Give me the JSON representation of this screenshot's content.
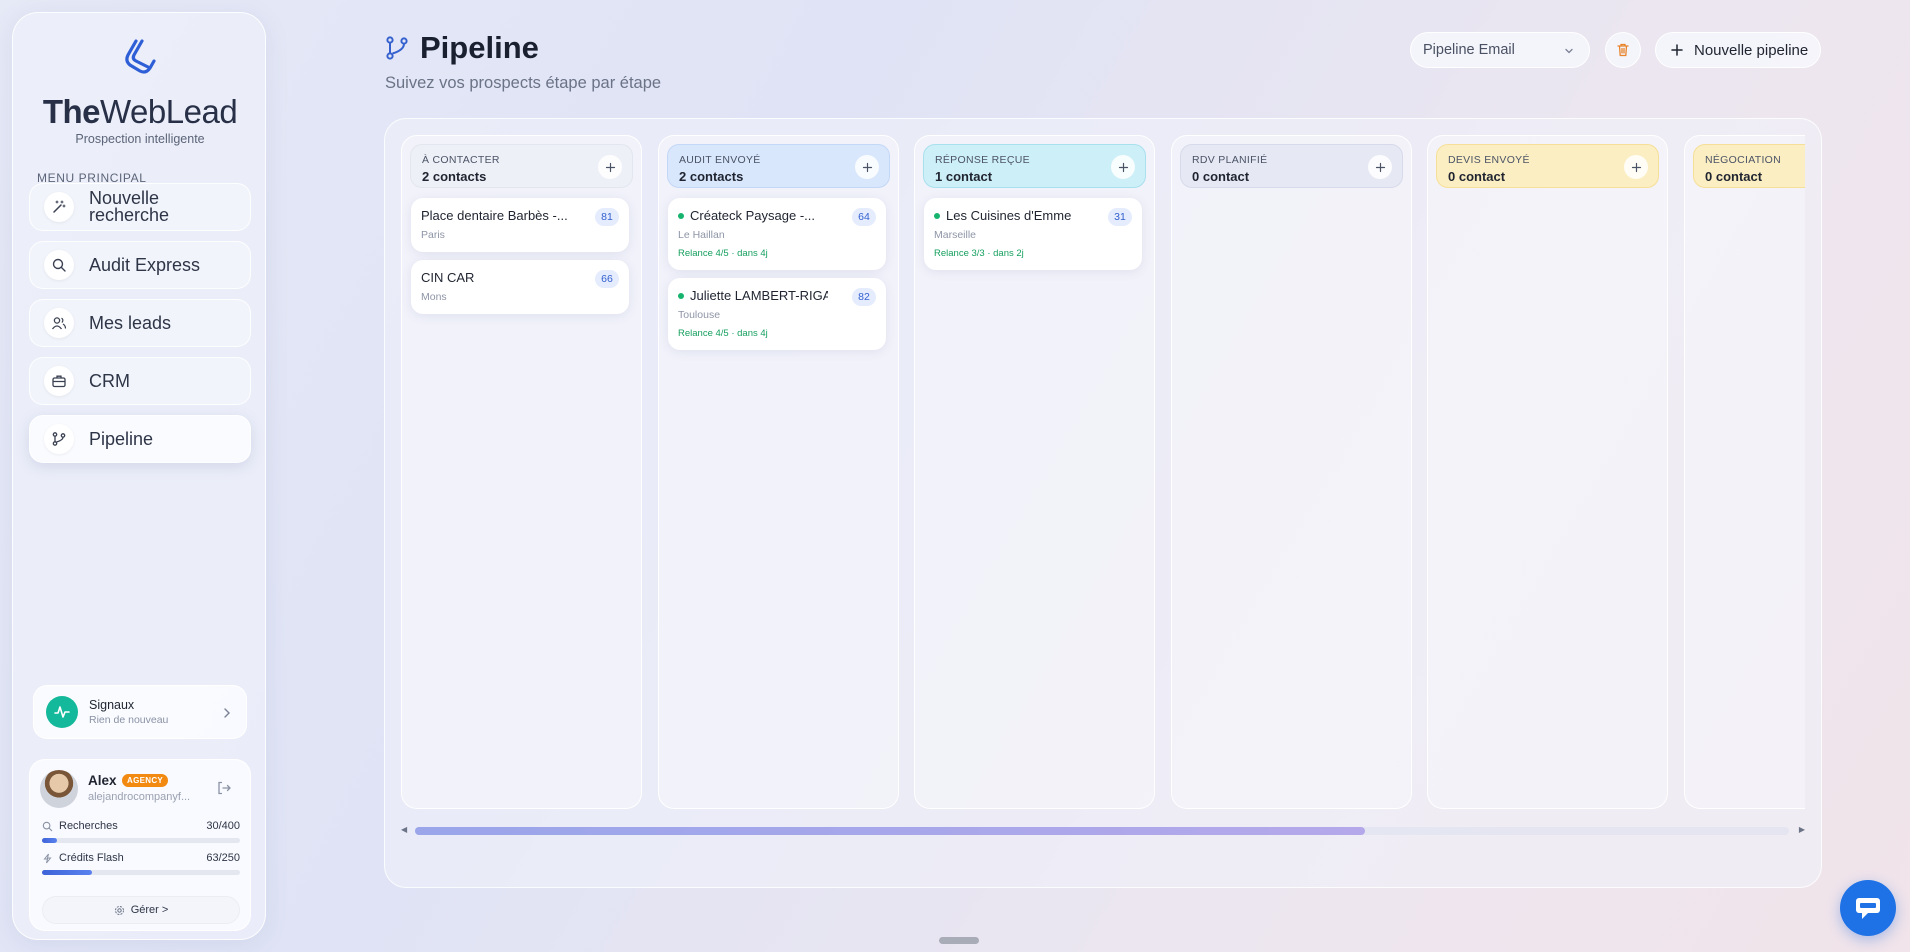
{
  "app": {
    "brand_the": "The",
    "brand_weblead": "WebLead",
    "tagline": "Prospection intelligente"
  },
  "sidebar": {
    "menu_title": "MENU PRINCIPAL",
    "items": [
      {
        "label": "Nouvelle recherche",
        "icon": "magic-wand-icon"
      },
      {
        "label": "Audit Express",
        "icon": "search-icon"
      },
      {
        "label": "Mes leads",
        "icon": "users-icon"
      },
      {
        "label": "CRM",
        "icon": "briefcase-icon"
      },
      {
        "label": "Pipeline",
        "icon": "git-branch-icon",
        "active": true
      }
    ],
    "signals": {
      "title": "Signaux",
      "subtitle": "Rien de nouveau"
    },
    "user": {
      "name": "Alex",
      "badge": "AGENCY",
      "email": "alejandrocompanyf...",
      "quotas": [
        {
          "label": "Recherches",
          "value": "30/400",
          "fraction": 0.075
        },
        {
          "label": "Crédits Flash",
          "value": "63/250",
          "fraction": 0.252
        }
      ],
      "manage_label": "Gérer >"
    }
  },
  "header": {
    "title": "Pipeline",
    "subtitle": "Suivez vos prospects étape par étape",
    "select_value": "Pipeline Email",
    "new_pipeline_label": "Nouvelle pipeline"
  },
  "colors": {
    "accent": "#3d63d8",
    "success": "#16a05f",
    "badge_orange": "#f28a12",
    "delete_orange": "#e8832a"
  },
  "columns": [
    {
      "title": "À CONTACTER",
      "count": "2 contacts",
      "bg": "#eef0f7",
      "border": "#e3e6ef",
      "cards": [
        {
          "name": "Place dentaire Barbès -...",
          "score": "81",
          "city": "Paris",
          "relance": "",
          "dot": false
        },
        {
          "name": "CIN CAR",
          "score": "66",
          "city": "Mons",
          "relance": "",
          "dot": false
        }
      ]
    },
    {
      "title": "AUDIT ENVOYÉ",
      "count": "2 contacts",
      "bg": "#d8e7fc",
      "border": "#c3d7f6",
      "cards": [
        {
          "name": "Créateck Paysage -...",
          "score": "64",
          "city": "Le Haillan",
          "relance": "Relance 4/5 · dans 4j",
          "dot": true
        },
        {
          "name": "Juliette LAMBERT-RIGA...",
          "score": "82",
          "city": "Toulouse",
          "relance": "Relance 4/5 · dans 4j",
          "dot": true
        }
      ]
    },
    {
      "title": "RÉPONSE REÇUE",
      "count": "1 contact",
      "bg": "#cdeff7",
      "border": "#a9e0ee",
      "cards": [
        {
          "name": "Les Cuisines d'Emme",
          "score": "31",
          "city": "Marseille",
          "relance": "Relance 3/3 · dans 2j",
          "dot": true
        }
      ]
    },
    {
      "title": "RDV PLANIFIÉ",
      "count": "0 contact",
      "bg": "#e6e8f4",
      "border": "#d7daea",
      "cards": []
    },
    {
      "title": "DEVIS ENVOYÉ",
      "count": "0 contact",
      "bg": "#fbeec2",
      "border": "#f6df98",
      "cards": []
    },
    {
      "title": "NÉGOCIATION",
      "count": "0 contact",
      "bg": "#fbeec2",
      "border": "#f6df98",
      "cards": []
    }
  ]
}
